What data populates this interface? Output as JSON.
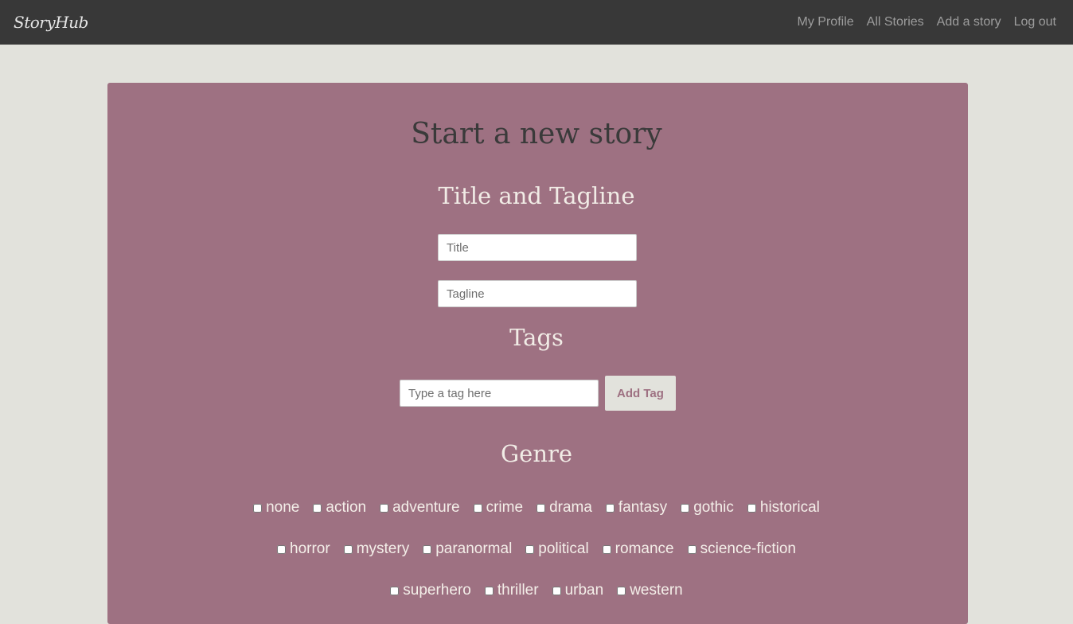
{
  "navbar": {
    "brand": "StoryHub",
    "links": [
      "My Profile",
      "All Stories",
      "Add a story",
      "Log out"
    ]
  },
  "main": {
    "title": "Start a new story",
    "title_section": {
      "heading": "Title and Tagline",
      "title_placeholder": "Title",
      "tagline_placeholder": "Tagline"
    },
    "tags_section": {
      "heading": "Tags",
      "tag_placeholder": "Type a tag here",
      "add_button": "Add Tag"
    },
    "genre_section": {
      "heading": "Genre",
      "rows": [
        [
          "none",
          "action",
          "adventure",
          "crime",
          "drama",
          "fantasy",
          "gothic",
          "historical"
        ],
        [
          "horror",
          "mystery",
          "paranormal",
          "political",
          "romance",
          "science-fiction"
        ],
        [
          "superhero",
          "thriller",
          "urban",
          "western"
        ]
      ]
    }
  },
  "colors": {
    "navbar": "#383838",
    "page_background": "#e2e2dc",
    "panel": "#9e7182",
    "heading_dark": "#3a3a3a",
    "heading_light": "#f1ece6"
  }
}
